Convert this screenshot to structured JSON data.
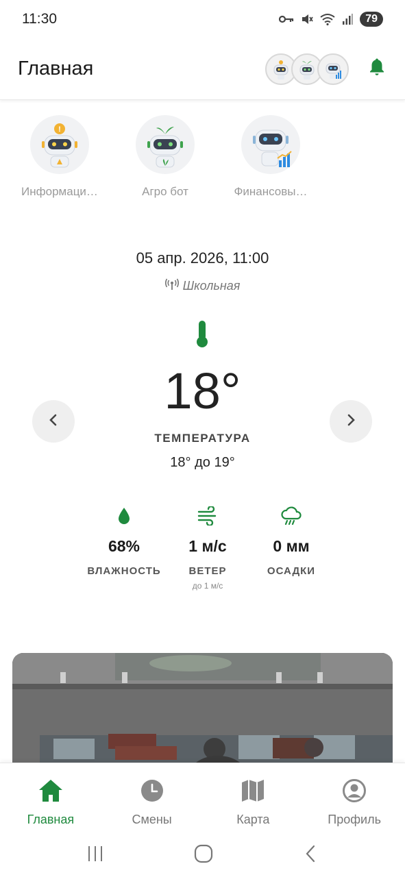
{
  "status_bar": {
    "time": "11:30",
    "battery": "79",
    "icons": [
      "key-icon",
      "mute-icon",
      "wifi-icon",
      "signal-icon"
    ]
  },
  "header": {
    "title": "Главная",
    "avatars": [
      "info-bot-avatar",
      "agro-bot-avatar",
      "finance-bot-avatar"
    ],
    "notification_icon": "bell-icon"
  },
  "bots": [
    {
      "label": "Информаци…",
      "icon": "info-bot-icon"
    },
    {
      "label": "Агро бот",
      "icon": "agro-bot-icon"
    },
    {
      "label": "Финансовы…",
      "icon": "finance-bot-icon"
    }
  ],
  "weather": {
    "datetime": "05 апр. 2026, 11:00",
    "station": "Школьная",
    "temperature": "18°",
    "temperature_label": "ТЕМПЕРАТУРА",
    "temperature_range": "18° до 19°",
    "metrics": [
      {
        "icon": "drop-icon",
        "value": "68%",
        "label": "ВЛАЖНОСТЬ",
        "sub": ""
      },
      {
        "icon": "wind-icon",
        "value": "1 м/с",
        "label": "ВЕТЕР",
        "sub": "до 1 м/с"
      },
      {
        "icon": "rain-cloud-icon",
        "value": "0 мм",
        "label": "ОСАДКИ",
        "sub": ""
      }
    ]
  },
  "bottom_nav": [
    {
      "label": "Главная",
      "icon": "home-icon",
      "active": true
    },
    {
      "label": "Смены",
      "icon": "clock-icon",
      "active": false
    },
    {
      "label": "Карта",
      "icon": "map-icon",
      "active": false
    },
    {
      "label": "Профиль",
      "icon": "profile-icon",
      "active": false
    }
  ],
  "colors": {
    "accent": "#1f8a3e",
    "text_muted": "#9a9a9a",
    "nav_inactive": "#777777"
  }
}
